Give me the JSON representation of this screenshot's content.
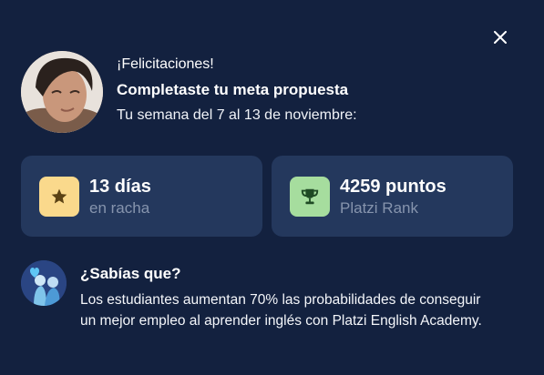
{
  "close": {
    "icon": "close-icon"
  },
  "header": {
    "avatar_icon": "user-avatar",
    "greeting": "¡Felicitaciones!",
    "goal": "Completaste tu meta propuesta",
    "week": "Tu semana del 7 al 13 de noviembre:"
  },
  "stats": [
    {
      "icon": "star-icon",
      "value": "13 días",
      "label": "en racha"
    },
    {
      "icon": "trophy-icon",
      "value": "4259 puntos",
      "label": "Platzi Rank"
    }
  ],
  "fact": {
    "icon": "people-heart-icon",
    "title": "¿Sabías que?",
    "body": "Los estudiantes aumentan 70% las probabilidades de conseguir un mejor empleo al aprender inglés con Platzi English Academy."
  },
  "colors": {
    "background": "#13213f",
    "card": "#24385d",
    "star_badge": "#fad98c",
    "trophy_badge": "#a6dd9e",
    "muted_text": "#8694ad"
  }
}
